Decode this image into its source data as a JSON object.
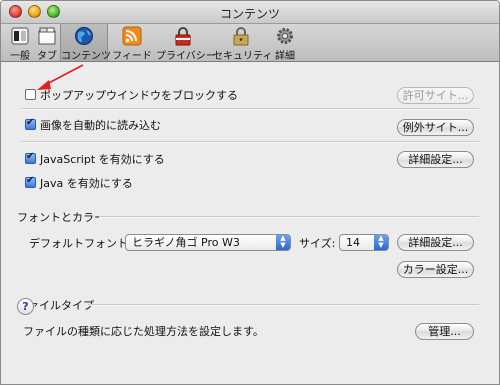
{
  "window": {
    "title": "コンテンツ"
  },
  "toolbar": {
    "items": [
      {
        "label": "一般",
        "icon": "switch-icon"
      },
      {
        "label": "タブ",
        "icon": "tabs-icon"
      },
      {
        "label": "コンテンツ",
        "icon": "globe-icon",
        "selected": true
      },
      {
        "label": "フィード",
        "icon": "rss-icon"
      },
      {
        "label": "プライバシー",
        "icon": "privacy-lock-icon"
      },
      {
        "label": "セキュリティ",
        "icon": "padlock-icon"
      },
      {
        "label": "詳細",
        "icon": "gear-icon"
      }
    ]
  },
  "content": {
    "popup_block_label": "ポップアップウインドウをブロックする",
    "popup_block_checked": false,
    "allowed_sites_button": "許可サイト...",
    "load_images_label": "画像を自動的に読み込む",
    "load_images_checked": true,
    "exceptions_button": "例外サイト...",
    "javascript_label": "JavaScript を有効にする",
    "javascript_checked": true,
    "advanced_button_1": "詳細設定...",
    "java_label": "Java を有効にする",
    "java_checked": true
  },
  "fonts": {
    "section_title": "フォントとカラー",
    "default_font_label": "デフォルトフォント:",
    "default_font_value": "ヒラギノ角ゴ Pro W3",
    "size_label": "サイズ:",
    "size_value": "14",
    "advanced_button": "詳細設定...",
    "colors_button": "カラー設定..."
  },
  "filetypes": {
    "section_title": "ファイルタイプ",
    "description": "ファイルの種類に応じた処理方法を設定します。",
    "manage_button": "管理..."
  },
  "help": {
    "label": "?"
  },
  "colors": {
    "annotation_arrow": "#e0201b",
    "accent": "#2e67cf"
  }
}
